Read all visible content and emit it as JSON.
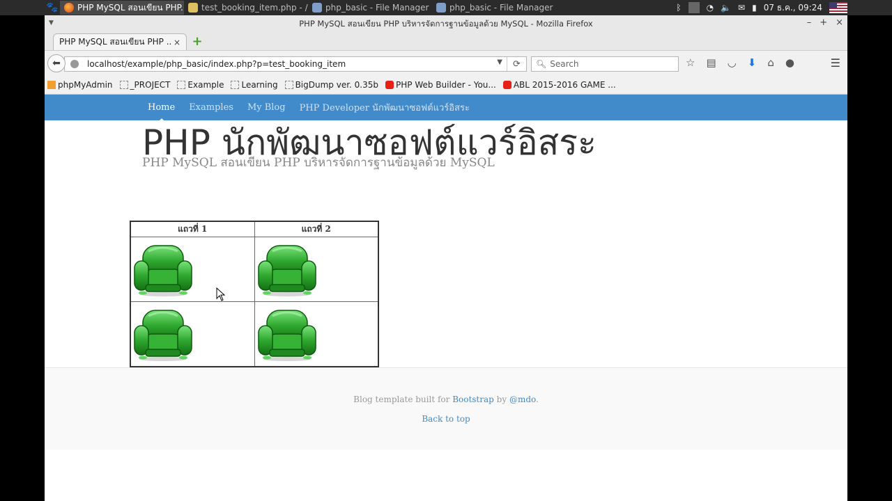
{
  "taskbar": {
    "items": [
      {
        "label": "PHP MySQL สอนเขียน PHP...",
        "active": true,
        "icon": "firefox-icon"
      },
      {
        "label": "test_booking_item.php - /v...",
        "active": false,
        "icon": "editor-icon"
      },
      {
        "label": "php_basic - File Manager",
        "active": false,
        "icon": "folder-icon"
      },
      {
        "label": "php_basic - File Manager",
        "active": false,
        "icon": "folder-icon"
      }
    ],
    "clock": "07 ธ.ค., 09:24"
  },
  "window": {
    "title": "PHP MySQL สอนเขียน PHP บริหารจัดการฐานข้อมูลด้วย MySQL - Mozilla Firefox",
    "controls": [
      "–",
      "+",
      "×"
    ]
  },
  "tab": {
    "title": "PHP MySQL สอนเขียน PHP ...",
    "close": "×",
    "new_tab": "+"
  },
  "navbar": {
    "url": "localhost/example/php_basic/index.php?p=test_booking_item",
    "search_placeholder": "Search"
  },
  "bookmarks": [
    {
      "label": "phpMyAdmin",
      "icon": "pma"
    },
    {
      "label": "_PROJECT",
      "icon": "folder"
    },
    {
      "label": "Example",
      "icon": "folder"
    },
    {
      "label": "Learning",
      "icon": "folder"
    },
    {
      "label": "BigDump ver. 0.35b",
      "icon": "folder"
    },
    {
      "label": "PHP Web Builder - You...",
      "icon": "yt"
    },
    {
      "label": "ABL 2015-2016 GAME ...",
      "icon": "yt"
    }
  ],
  "blog": {
    "nav": [
      "Home",
      "Examples",
      "My Blog",
      "PHP Developer นักพัฒนาซอฟต์แวร์อิสระ"
    ],
    "title": "PHP นักพัฒนาซอฟต์แวร์อิสระ",
    "description": "PHP MySQL สอนเขียน PHP บริหารจัดการฐานข้อมูลด้วย MySQL"
  },
  "booking_table": {
    "headers": [
      "แถวที่ 1",
      "แถวที่ 2"
    ],
    "rows": [
      [
        "armchair-icon",
        "armchair-icon"
      ],
      [
        "armchair-icon",
        "armchair-icon"
      ]
    ],
    "seat_color": "#2fa82f"
  },
  "footer": {
    "text_before": "Blog template built for ",
    "link1": "Bootstrap",
    "text_mid": " by ",
    "link2": "@mdo",
    "text_after": ".",
    "back_to_top": "Back to top"
  },
  "colors": {
    "nav_bg": "#428bca",
    "link": "#428bca"
  }
}
